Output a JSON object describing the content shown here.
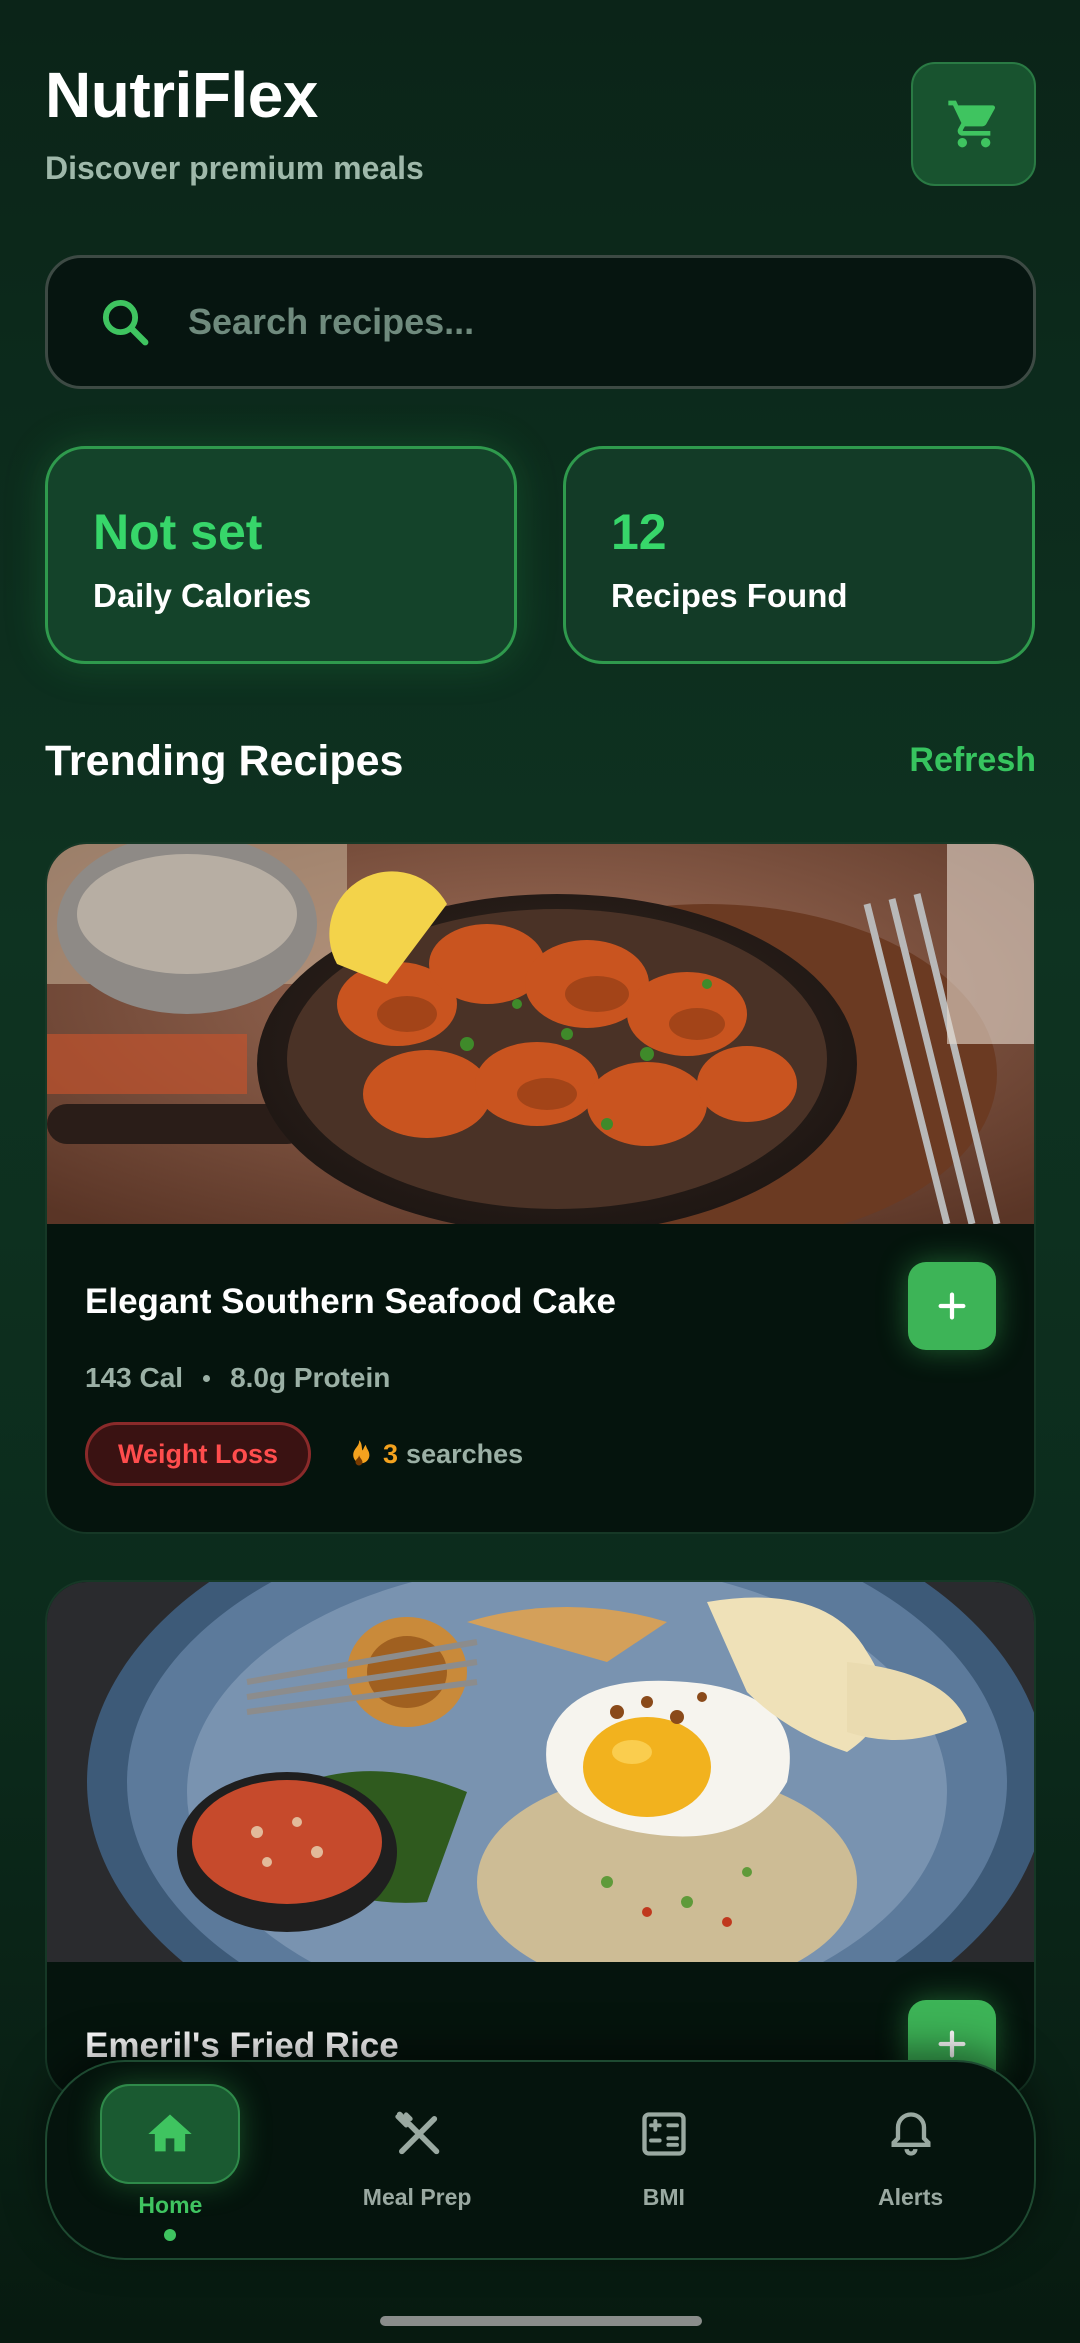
{
  "header": {
    "title": "NutriFlex",
    "subtitle": "Discover premium meals"
  },
  "search": {
    "placeholder": "Search recipes..."
  },
  "stats": [
    {
      "value": "Not set",
      "label": "Daily Calories"
    },
    {
      "value": "12",
      "label": "Recipes Found"
    }
  ],
  "section": {
    "title": "Trending Recipes",
    "action": "Refresh"
  },
  "recipes": [
    {
      "name": "Elegant Southern Seafood Cake",
      "calories": "143 Cal",
      "protein": "8.0g Protein",
      "tag": "Weight Loss",
      "search_count": "3",
      "search_label": "searches"
    },
    {
      "name": "Emeril's Fried Rice"
    }
  ],
  "nav": [
    {
      "label": "Home",
      "icon": "home-icon"
    },
    {
      "label": "Meal Prep",
      "icon": "utensils-icon"
    },
    {
      "label": "BMI",
      "icon": "calculator-icon"
    },
    {
      "label": "Alerts",
      "icon": "bell-icon"
    }
  ],
  "colors": {
    "accent": "#37d66a",
    "tag_red": "#ff4d4d",
    "flame": "#f4a21e"
  }
}
